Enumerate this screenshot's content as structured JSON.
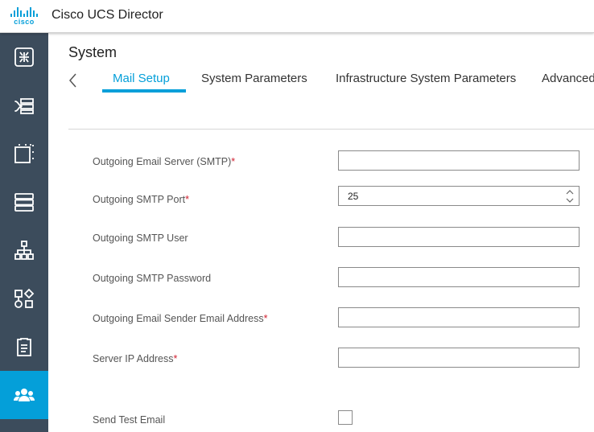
{
  "header": {
    "logo_text": "cisco",
    "app_title": "Cisco UCS Director"
  },
  "sidebar": {
    "items": [
      {
        "icon": "dashboard-icon"
      },
      {
        "icon": "converged-icon"
      },
      {
        "icon": "virtual-icon"
      },
      {
        "icon": "physical-servers-icon"
      },
      {
        "icon": "network-topology-icon"
      },
      {
        "icon": "orchestration-icon"
      },
      {
        "icon": "policies-icon"
      },
      {
        "icon": "users-group-icon",
        "active": true
      }
    ],
    "active_color": "#049fd9",
    "background_color": "#3c4c5c"
  },
  "page": {
    "title": "System"
  },
  "tabs": [
    {
      "label": "Mail Setup",
      "active": true
    },
    {
      "label": "System Parameters"
    },
    {
      "label": "Infrastructure System Parameters"
    },
    {
      "label": "Advanced"
    }
  ],
  "form": {
    "smtp_server": {
      "label": "Outgoing Email Server (SMTP)",
      "required": "*",
      "value": ""
    },
    "smtp_port": {
      "label": "Outgoing SMTP Port",
      "required": "*",
      "value": "25"
    },
    "smtp_user": {
      "label": "Outgoing SMTP User",
      "value": ""
    },
    "smtp_password": {
      "label": "Outgoing SMTP Password",
      "value": ""
    },
    "sender_email": {
      "label": "Outgoing Email Sender Email Address",
      "required": "*",
      "value": ""
    },
    "server_ip": {
      "label": "Server IP Address",
      "required": "*",
      "value": ""
    },
    "send_test_email": {
      "label": "Send Test Email",
      "checked": false
    }
  }
}
